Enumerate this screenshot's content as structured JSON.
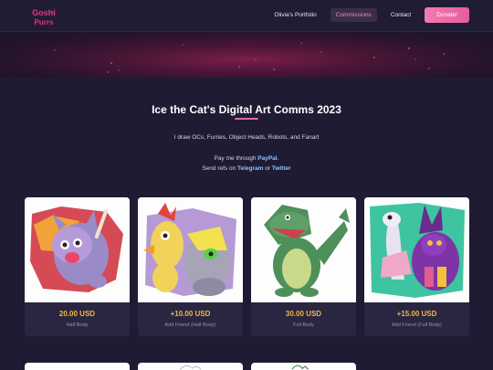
{
  "brand": {
    "logo_text": "Goshi Purrs"
  },
  "nav": {
    "portfolio": "Olivia's Portfolio",
    "commissions": "Commissions",
    "contact": "Contact",
    "donate": "Donate!"
  },
  "header": {
    "title": "Ice the Cat's Digital Art Comms 2023",
    "intro": "I draw OCs, Furries, Object Heads, Robots, and Fanart",
    "pay_prefix": "Pay me through ",
    "pay_link": "PayPal",
    "pay_suffix": ".",
    "refs_prefix": "Send refs on ",
    "refs_link1": "Telegram",
    "refs_or": " or ",
    "refs_link2": "Twitter"
  },
  "cards": [
    {
      "price": "20.00 USD",
      "label": "Half Body"
    },
    {
      "price": "+10.00 USD",
      "label": "Add Friend (Half Body)"
    },
    {
      "price": "30.00 USD",
      "label": "Full Body"
    },
    {
      "price": "+15.00 USD",
      "label": "Add Friend (Full Body)"
    }
  ],
  "colors": {
    "background": "#1f1b33",
    "accent_pink": "#e45d9e",
    "price_gold": "#f0b848",
    "link_blue": "#8fc2ff"
  }
}
